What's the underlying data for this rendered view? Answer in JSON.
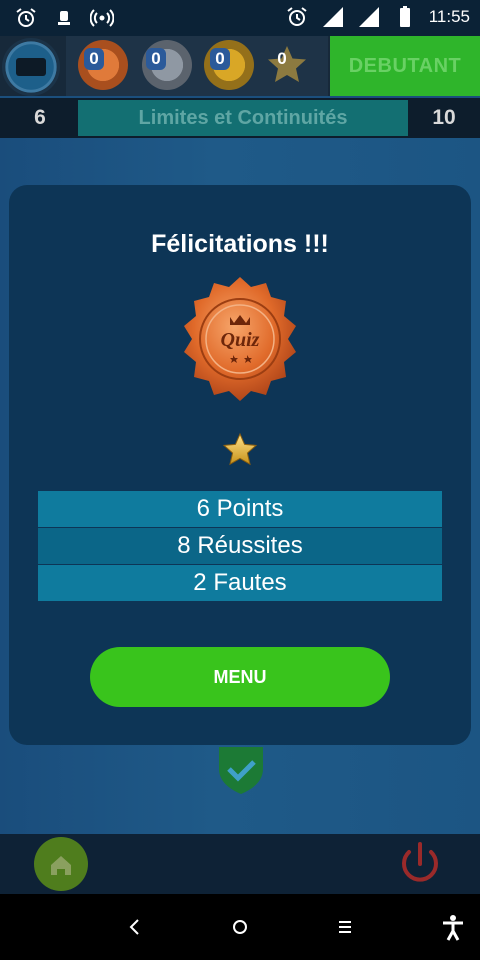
{
  "status_bar": {
    "time": "11:55",
    "icons": [
      "alarm-icon",
      "notification-icon",
      "hotspot-icon",
      "alarm-icon",
      "signal-icon",
      "signal-icon",
      "battery-icon"
    ]
  },
  "header": {
    "medals": [
      {
        "name": "bronze-medal-icon",
        "count": "0",
        "color": "#c9642c"
      },
      {
        "name": "silver-medal-icon",
        "count": "0",
        "color": "#6c7683"
      },
      {
        "name": "gold-medal-icon",
        "count": "0",
        "color": "#b68a1a"
      },
      {
        "name": "star-medal-icon",
        "count": "0",
        "color": "#8a7a3f"
      }
    ],
    "level": "DEBUTANT"
  },
  "subheader": {
    "left_value": "6",
    "title": "Limites et Continuités",
    "right_value": "10"
  },
  "result": {
    "title": "Félicitations !!!",
    "badge_text": "Quiz",
    "stars": 1,
    "points": "6 Points",
    "successes": "8 Réussites",
    "errors": "2 Fautes",
    "menu_label": "MENU"
  },
  "colors": {
    "accent_green": "#39c41c",
    "card_bg": "#0d3556",
    "stat_row": "#0f7b9e"
  }
}
